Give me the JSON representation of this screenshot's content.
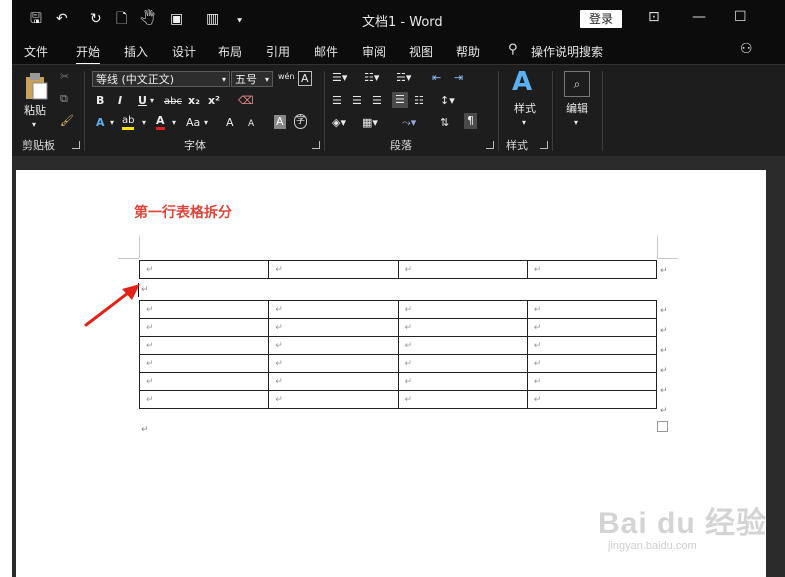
{
  "title_bar": {
    "quick_access": [
      "🖫",
      "↶",
      "↻",
      "🗋",
      "🖑",
      "▣",
      "▥",
      "⯆"
    ],
    "doc_title": "文档1  -  Word",
    "login": "登录",
    "controls": [
      "⊡",
      "—",
      "☐"
    ]
  },
  "tabs": [
    "文件",
    "开始",
    "插入",
    "设计",
    "布局",
    "引用",
    "邮件",
    "审阅",
    "视图",
    "帮助",
    "操作说明搜索"
  ],
  "ribbon": {
    "clipboard": {
      "paste": "粘贴",
      "label": "剪贴板"
    },
    "font": {
      "font_name": "等线 (中文正文)",
      "font_size": "五号",
      "wen": "wén",
      "a_box": "A",
      "bold": "B",
      "italic": "I",
      "underline": "U",
      "strike": "abc",
      "sub": "x₂",
      "sup": "x²",
      "effects": "A",
      "highlight": "ab",
      "color": "A",
      "case": "Aa",
      "grow": "A",
      "shrink": "A",
      "char_shade": "A",
      "enclose": "字",
      "label": "字体"
    },
    "paragraph": {
      "label": "段落"
    },
    "styles": {
      "btn": "样式",
      "label": "样式"
    },
    "editing": {
      "btn": "编辑"
    }
  },
  "document": {
    "heading": "第一行表格拆分",
    "para_mark": "↵",
    "table_top": {
      "rows": 1,
      "cols": 4
    },
    "table_bottom": {
      "rows": 6,
      "cols": 4
    }
  },
  "watermark": {
    "logo": "Bai du 经验",
    "sub": "jingyan.baidu.com"
  },
  "colors": {
    "heading": "#e0453a",
    "arrow": "#e2231a",
    "ribbon": "#1d1d1d"
  }
}
